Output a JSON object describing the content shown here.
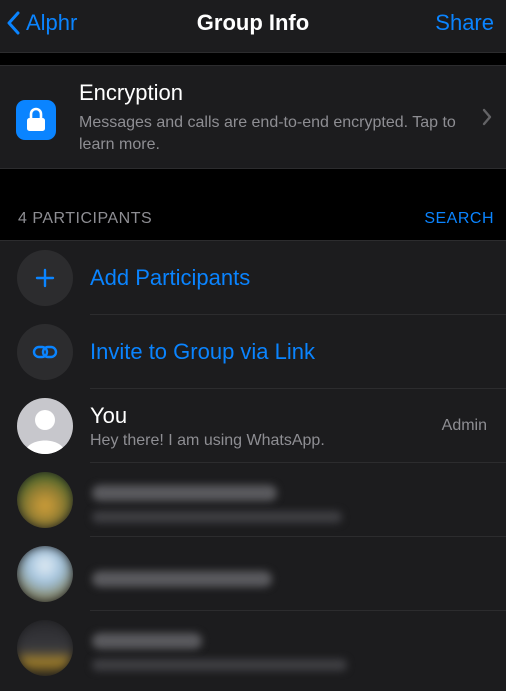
{
  "nav": {
    "back_label": "Alphr",
    "title": "Group Info",
    "share_label": "Share"
  },
  "encryption": {
    "title": "Encryption",
    "description": "Messages and calls are end-to-end encrypted. Tap to learn more."
  },
  "participants": {
    "count_label": "4 PARTICIPANTS",
    "search_label": "SEARCH",
    "actions": [
      {
        "label": "Add Participants"
      },
      {
        "label": "Invite to Group via Link"
      }
    ],
    "members": [
      {
        "name": "You",
        "status": "Hey there! I am using WhatsApp.",
        "role": "Admin"
      }
    ]
  },
  "colors": {
    "accent": "#0a84ff",
    "background": "#000000",
    "cell": "#1c1c1e",
    "secondary_text": "#8e8e93"
  },
  "icons": [
    "chevron-left-icon",
    "lock-icon",
    "chevron-right-icon",
    "plus-icon",
    "link-icon",
    "person-icon"
  ]
}
